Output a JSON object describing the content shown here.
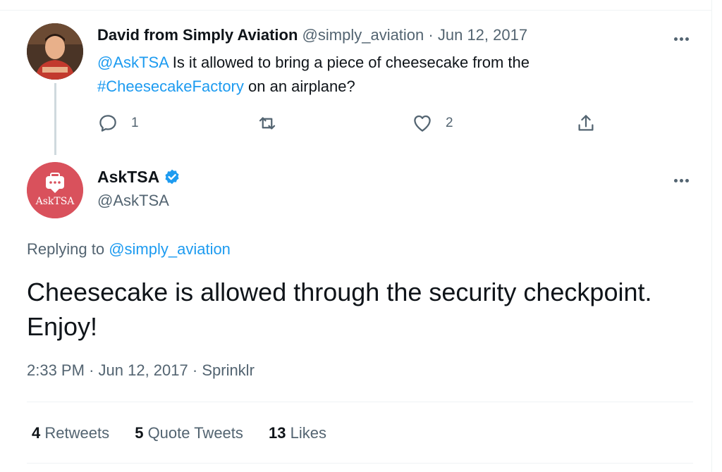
{
  "original_tweet": {
    "display_name": "David from Simply Aviation",
    "handle": "@simply_aviation",
    "separator": "·",
    "date": "Jun 12, 2017",
    "mention": "@AskTSA",
    "text_part1": " Is it allowed to bring a piece of cheesecake from the",
    "hashtag": "#CheesecakeFactory",
    "text_part2": " on an airplane?",
    "reply_count": "1",
    "retweet_count": "",
    "like_count": "2"
  },
  "reply_tweet": {
    "display_name": "AskTSA",
    "verified": true,
    "handle": "@AskTSA",
    "avatar_label": "AskTSA",
    "replying_prefix": "Replying to ",
    "replying_to": "@simply_aviation",
    "text": "Cheesecake is allowed through the security checkpoint. Enjoy!",
    "time": "2:33 PM",
    "date": "Jun 12, 2017",
    "source": "Sprinklr",
    "separator": "·"
  },
  "stats": {
    "retweets_count": "4",
    "retweets_label": " Retweets",
    "quote_count": "5",
    "quote_label": " Quote Tweets",
    "likes_count": "13",
    "likes_label": " Likes"
  },
  "colors": {
    "link": "#1d9bf0",
    "muted": "#536471",
    "verified": "#1d9bf0",
    "asktsa_brand": "#d9515c"
  },
  "icons": [
    "reply-icon",
    "retweet-icon",
    "like-icon",
    "share-icon",
    "more-icon",
    "verified-badge-icon",
    "chat-bubble-icon"
  ]
}
